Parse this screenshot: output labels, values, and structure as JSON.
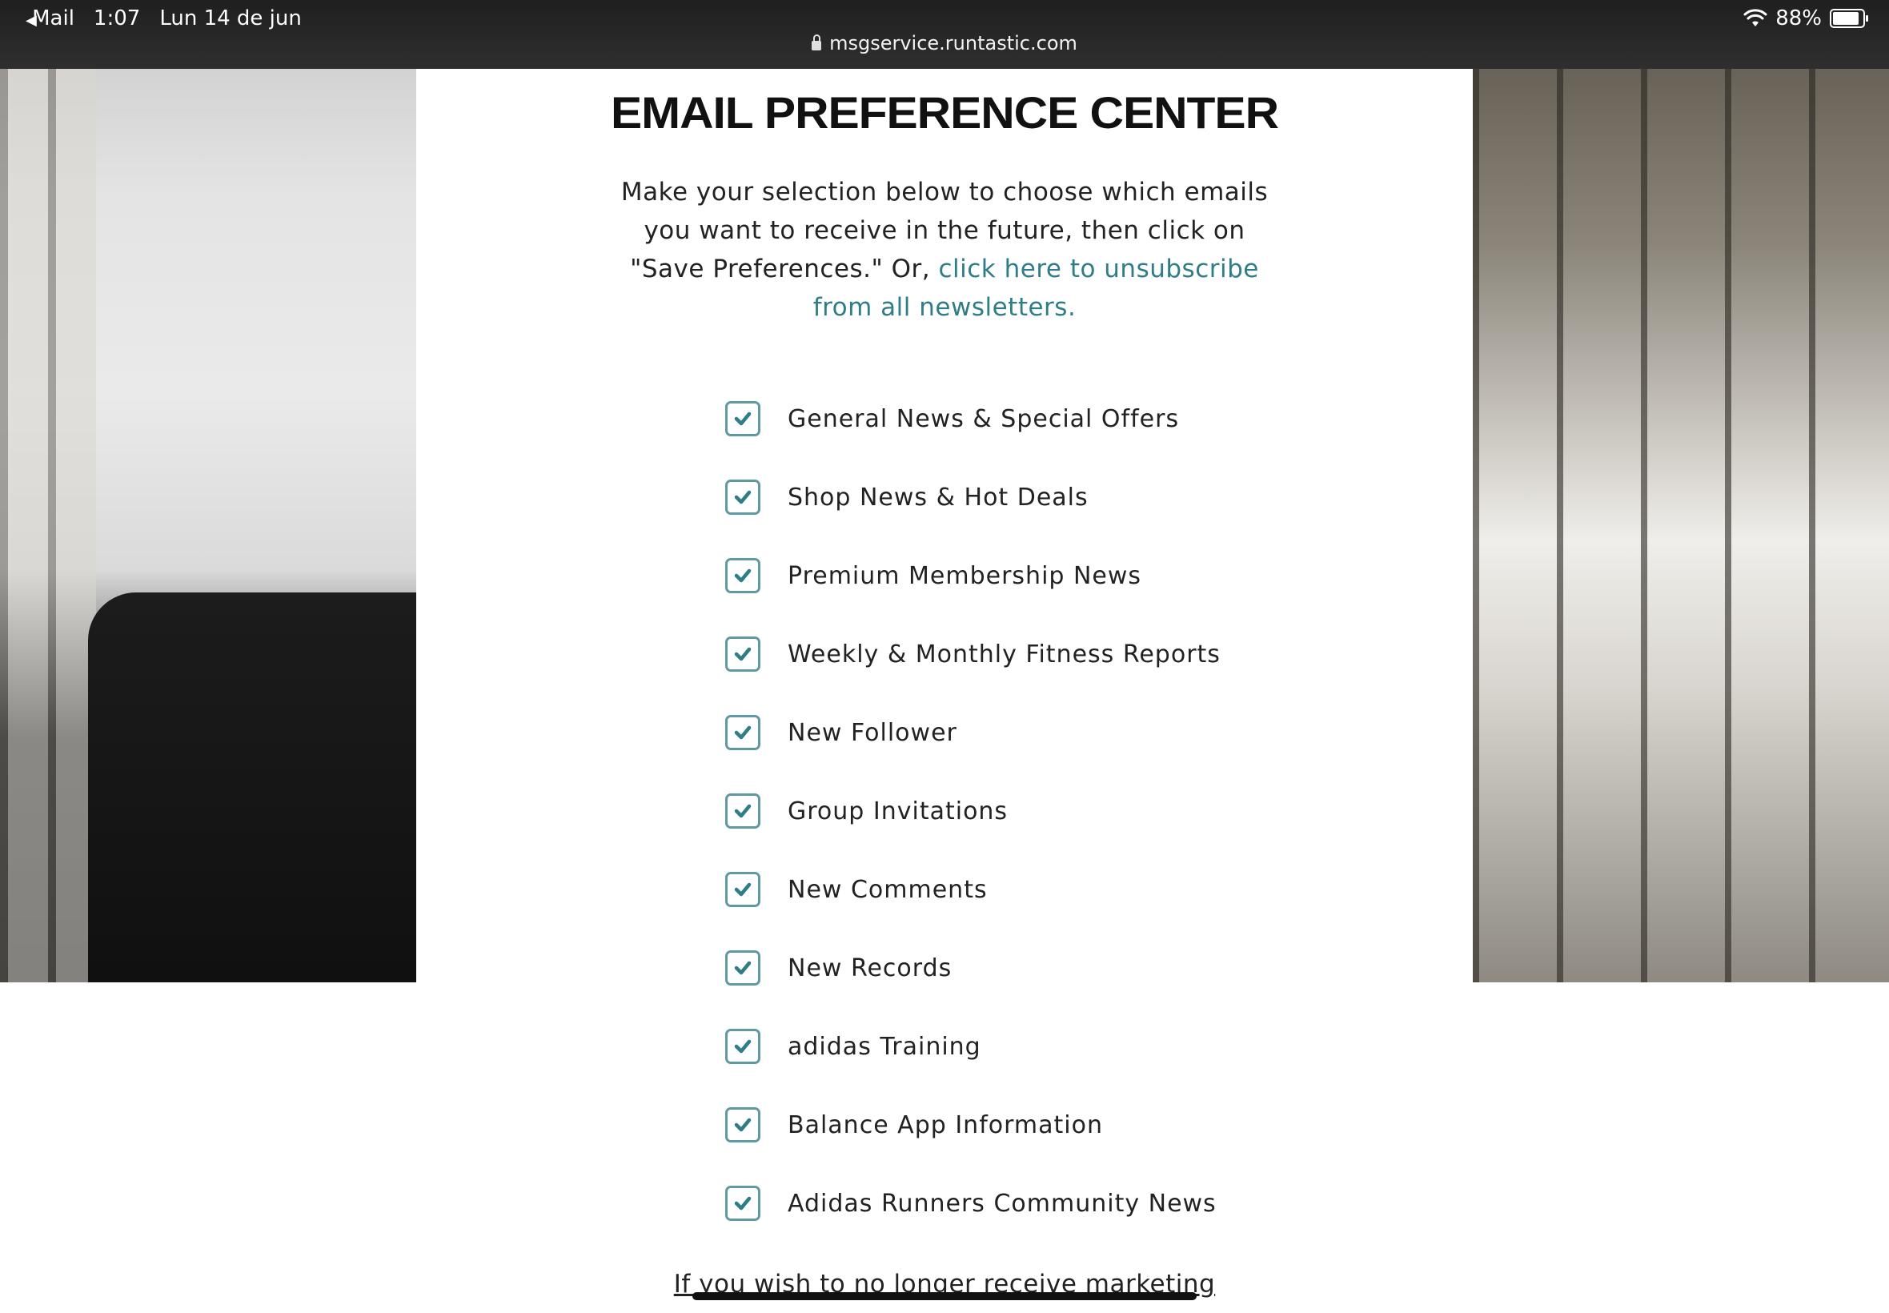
{
  "status_bar": {
    "back_label": "Mail",
    "time": "1:07",
    "date": "Lun 14 de jun",
    "battery": "88%",
    "url": "msgservice.runtastic.com"
  },
  "page": {
    "title": "EMAIL PREFERENCE CENTER",
    "intro_text": "Make your selection below to choose which emails you want to receive in the future, then click on \"Save Preferences.\" Or, ",
    "unsubscribe_link": "click here to unsubscribe from all newsletters.",
    "footer_text": "If you wish to no longer receive marketing",
    "accent_color": "#2f7d86"
  },
  "preferences": [
    {
      "label": "General News & Special Offers",
      "checked": true
    },
    {
      "label": "Shop News & Hot Deals",
      "checked": true
    },
    {
      "label": "Premium Membership News",
      "checked": true
    },
    {
      "label": "Weekly & Monthly Fitness Reports",
      "checked": true
    },
    {
      "label": "New Follower",
      "checked": true
    },
    {
      "label": "Group Invitations",
      "checked": true
    },
    {
      "label": "New Comments",
      "checked": true
    },
    {
      "label": "New Records",
      "checked": true
    },
    {
      "label": "adidas Training",
      "checked": true
    },
    {
      "label": "Balance App Information",
      "checked": true
    },
    {
      "label": "Adidas Runners Community News",
      "checked": true
    }
  ]
}
